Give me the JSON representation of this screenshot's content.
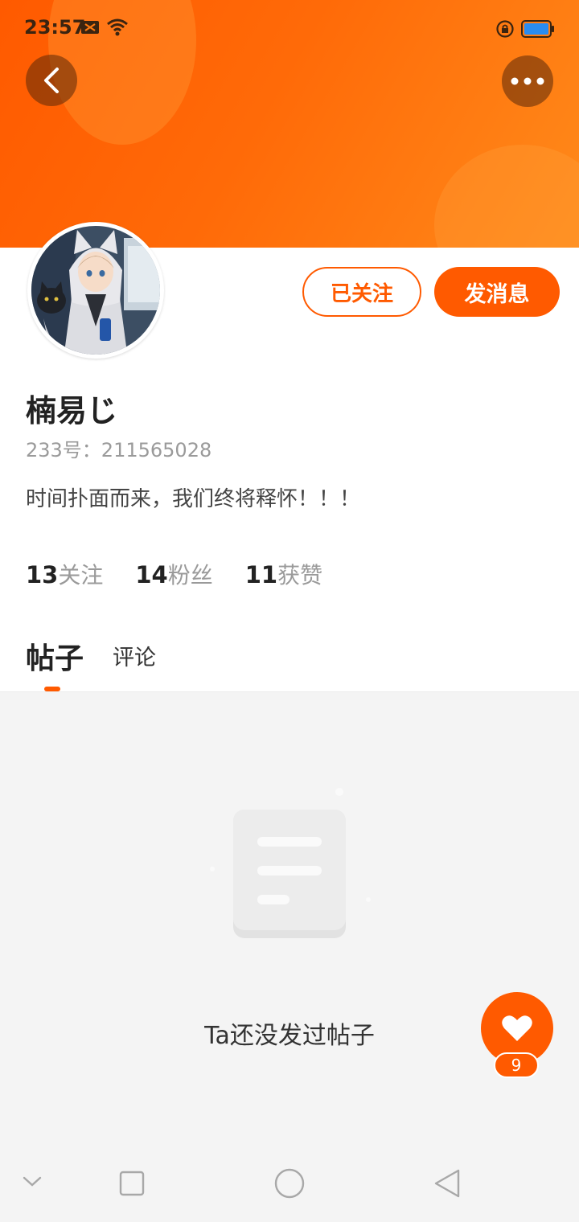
{
  "status_bar": {
    "time": "23:57",
    "icons": [
      "mail-icon",
      "wifi-icon",
      "rotation-lock-icon",
      "battery-icon"
    ]
  },
  "header": {
    "back_icon": "chevron-left-icon",
    "more_icon": "more-dots-icon",
    "gradient_colors": [
      "#ff5a00",
      "#ff8a1a"
    ]
  },
  "profile": {
    "username": "楠易じ",
    "user_id": "233号：211565028",
    "bio": "时间扑面而来，我们终将释怀！！！",
    "follow_label": "已关注",
    "message_label": "发消息",
    "stats": [
      {
        "count": "13",
        "label": "关注"
      },
      {
        "count": "14",
        "label": "粉丝"
      },
      {
        "count": "11",
        "label": "获赞"
      }
    ]
  },
  "tabs": [
    {
      "label": "帖子",
      "active": true
    },
    {
      "label": "评论",
      "active": false
    }
  ],
  "content": {
    "empty_message": "Ta还没发过帖子",
    "empty_icon": "document-icon"
  },
  "like_button": {
    "icon": "heart-icon",
    "count": "9"
  },
  "nav_bar": {
    "icons": [
      "chevron-down-icon",
      "recent-apps-icon",
      "home-circle-icon",
      "back-triangle-icon"
    ]
  },
  "colors": {
    "accent": "#ff5a00",
    "muted_text": "#9a9a9a",
    "content_bg": "#f4f4f4"
  }
}
